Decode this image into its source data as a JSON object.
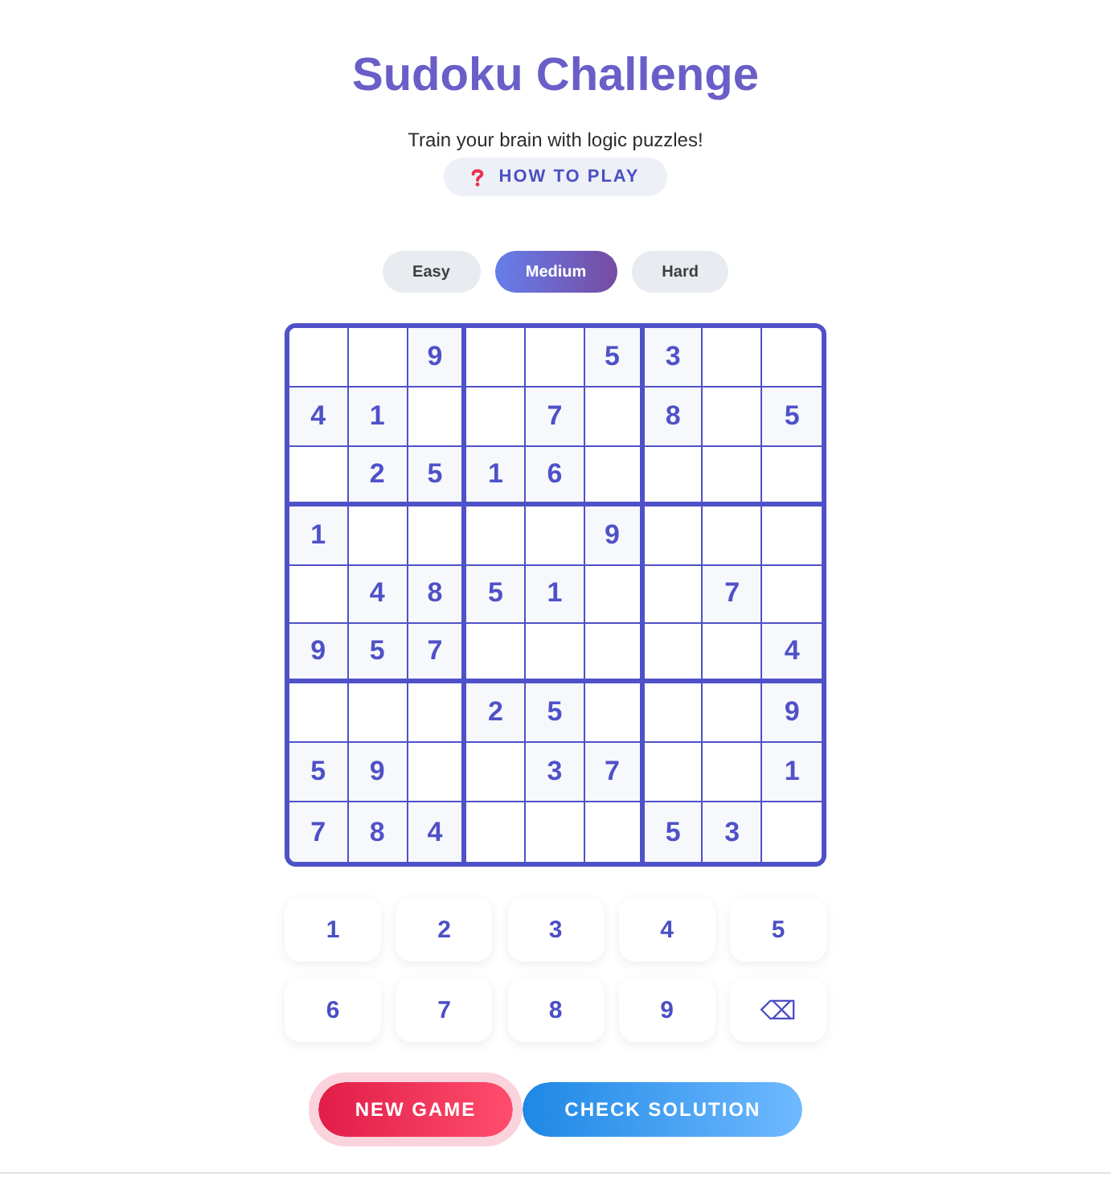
{
  "title": "Sudoku Challenge",
  "subtitle": "Train your brain with logic puzzles!",
  "help_button": {
    "label": "HOW TO PLAY"
  },
  "difficulty": [
    {
      "label": "Easy",
      "selected": false
    },
    {
      "label": "Medium",
      "selected": true
    },
    {
      "label": "Hard",
      "selected": false
    }
  ],
  "board": {
    "rows": [
      [
        null,
        null,
        "9",
        null,
        null,
        "5",
        "3",
        null,
        null
      ],
      [
        "4",
        "1",
        null,
        null,
        "7",
        null,
        "8",
        null,
        "5"
      ],
      [
        null,
        "2",
        "5",
        "1",
        "6",
        null,
        null,
        null,
        null
      ],
      [
        "1",
        null,
        null,
        null,
        null,
        "9",
        null,
        null,
        null
      ],
      [
        null,
        "4",
        "8",
        "5",
        "1",
        null,
        null,
        "7",
        null
      ],
      [
        "9",
        "5",
        "7",
        null,
        null,
        null,
        null,
        null,
        "4"
      ],
      [
        null,
        null,
        null,
        "2",
        "5",
        null,
        null,
        null,
        "9"
      ],
      [
        "5",
        "9",
        null,
        null,
        "3",
        "7",
        null,
        null,
        "1"
      ],
      [
        "7",
        "8",
        "4",
        null,
        null,
        null,
        "5",
        "3",
        null
      ]
    ]
  },
  "keypad": [
    {
      "label": "1",
      "kind": "digit"
    },
    {
      "label": "2",
      "kind": "digit"
    },
    {
      "label": "3",
      "kind": "digit"
    },
    {
      "label": "4",
      "kind": "digit"
    },
    {
      "label": "5",
      "kind": "digit"
    },
    {
      "label": "6",
      "kind": "digit"
    },
    {
      "label": "7",
      "kind": "digit"
    },
    {
      "label": "8",
      "kind": "digit"
    },
    {
      "label": "9",
      "kind": "digit"
    },
    {
      "label": "⌫",
      "kind": "erase"
    }
  ],
  "actions": [
    {
      "label": "NEW GAME",
      "kind": "reset",
      "focused": true
    },
    {
      "label": "CHECK SOLUTION",
      "kind": "verify",
      "focused": false
    }
  ]
}
